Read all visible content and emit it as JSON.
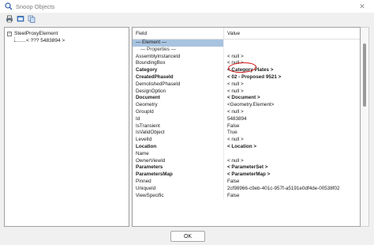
{
  "window": {
    "title": "Snoop Objects",
    "close_glyph": "✕"
  },
  "toolbar": {
    "icons": [
      "print-icon",
      "print-preview-icon",
      "copy-icon"
    ]
  },
  "tree": {
    "root": "SteelProxyElement",
    "expander": "−",
    "child": "< ??? 5483894 >"
  },
  "grid": {
    "headers": {
      "field": "Field",
      "value": "Value"
    },
    "rows": [
      {
        "field": "— Element —",
        "value": "",
        "kind": "section"
      },
      {
        "field": "— Properties —",
        "value": "",
        "kind": "subsection"
      },
      {
        "field": "AssemblyInstanceId",
        "value": "< null >",
        "kind": "normal"
      },
      {
        "field": "BoundingBox",
        "value": "< null >",
        "kind": "normal"
      },
      {
        "field": "Category",
        "value": "< Category   Plates >",
        "kind": "bold"
      },
      {
        "field": "CreatedPhaseId",
        "value": "< 02 - Proposed   9521 >",
        "kind": "bold"
      },
      {
        "field": "DemolishedPhaseId",
        "value": "< null >",
        "kind": "normal"
      },
      {
        "field": "DesignOption",
        "value": "< null >",
        "kind": "normal"
      },
      {
        "field": "Document",
        "value": "< Document >",
        "kind": "bold"
      },
      {
        "field": "Geometry",
        "value": "<Geometry.Element>",
        "kind": "normal"
      },
      {
        "field": "GroupId",
        "value": "< null >",
        "kind": "normal"
      },
      {
        "field": "Id",
        "value": "5483894",
        "kind": "normal"
      },
      {
        "field": "IsTransient",
        "value": "False",
        "kind": "normal"
      },
      {
        "field": "IsValidObject",
        "value": "True",
        "kind": "normal"
      },
      {
        "field": "LevelId",
        "value": "< null >",
        "kind": "normal"
      },
      {
        "field": "Location",
        "value": "< Location >",
        "kind": "bold"
      },
      {
        "field": "Name",
        "value": "",
        "kind": "normal"
      },
      {
        "field": "OwnerViewId",
        "value": "< null >",
        "kind": "normal"
      },
      {
        "field": "Parameters",
        "value": "< ParameterSet >",
        "kind": "bold"
      },
      {
        "field": "ParametersMap",
        "value": "< ParameterMap >",
        "kind": "bold"
      },
      {
        "field": "Pinned",
        "value": "False",
        "kind": "normal"
      },
      {
        "field": "UniqueId",
        "value": "2cf98966-c9eb-401c-957f-a5191e0df4de-00538f02",
        "kind": "normal"
      },
      {
        "field": "ViewSpecific",
        "value": "False",
        "kind": "normal"
      }
    ]
  },
  "footer": {
    "ok_label": "OK"
  },
  "colors": {
    "section_bg": "#a8c3df",
    "annotation_circle": "#d31010"
  }
}
